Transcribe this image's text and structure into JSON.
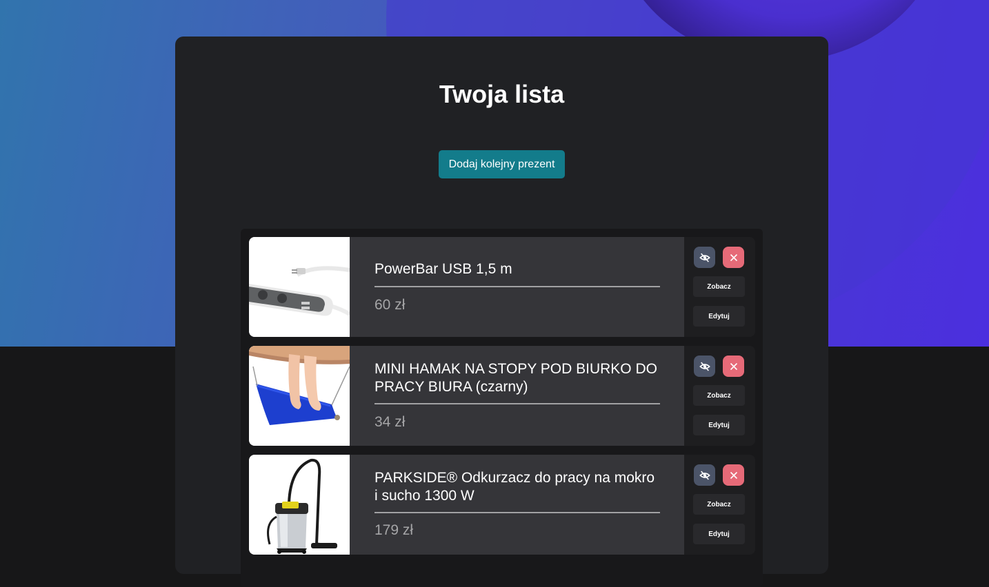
{
  "page": {
    "title": "Twoja lista",
    "add_button_label": "Dodaj kolejny prezent"
  },
  "items": [
    {
      "name": "PowerBar USB 1,5 m",
      "price": "60 zł",
      "image": "power-strip-image",
      "hide_icon": "eye-off-icon",
      "delete_icon": "close-icon",
      "view_label": "Zobacz",
      "edit_label": "Edytuj"
    },
    {
      "name": "MINI HAMAK NA STOPY POD BIURKO DO PRACY BIURA (czarny)",
      "price": "34 zł",
      "image": "foot-hammock-image",
      "hide_icon": "eye-off-icon",
      "delete_icon": "close-icon",
      "view_label": "Zobacz",
      "edit_label": "Edytuj"
    },
    {
      "name": "PARKSIDE® Odkurzacz do pracy na mokro i sucho 1300 W",
      "price": "179 zł",
      "image": "wet-dry-vacuum-image",
      "hide_icon": "eye-off-icon",
      "delete_icon": "close-icon",
      "view_label": "Zobacz",
      "edit_label": "Edytuj"
    }
  ],
  "colors": {
    "accent_button": "#137c8b",
    "hide_button": "#4b5468",
    "delete_button": "#e66a78",
    "panel": "#202124",
    "item_info": "#353539"
  }
}
